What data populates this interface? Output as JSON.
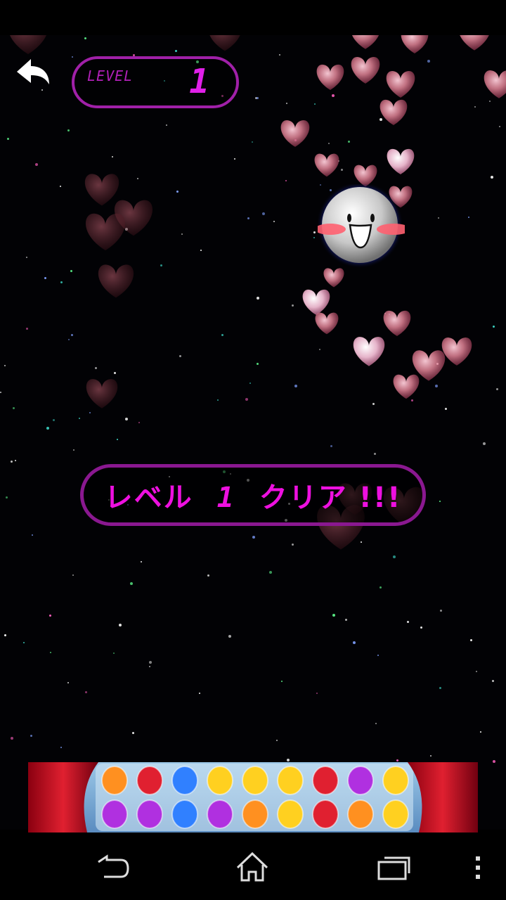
{
  "hud": {
    "level_label": "LEVEL",
    "level_value": "1"
  },
  "banner": {
    "prefix": "レベル",
    "level": "1",
    "suffix": "クリア !!!"
  },
  "icons": {
    "back": "back-arrow-icon",
    "nav_back": "nav-back-icon",
    "nav_home": "nav-home-icon",
    "nav_recent": "nav-recent-apps-icon",
    "nav_menu": "nav-overflow-menu-icon"
  },
  "colors": {
    "accent": "#e020e8",
    "border": "#a020a8",
    "heart": "#f08090"
  }
}
